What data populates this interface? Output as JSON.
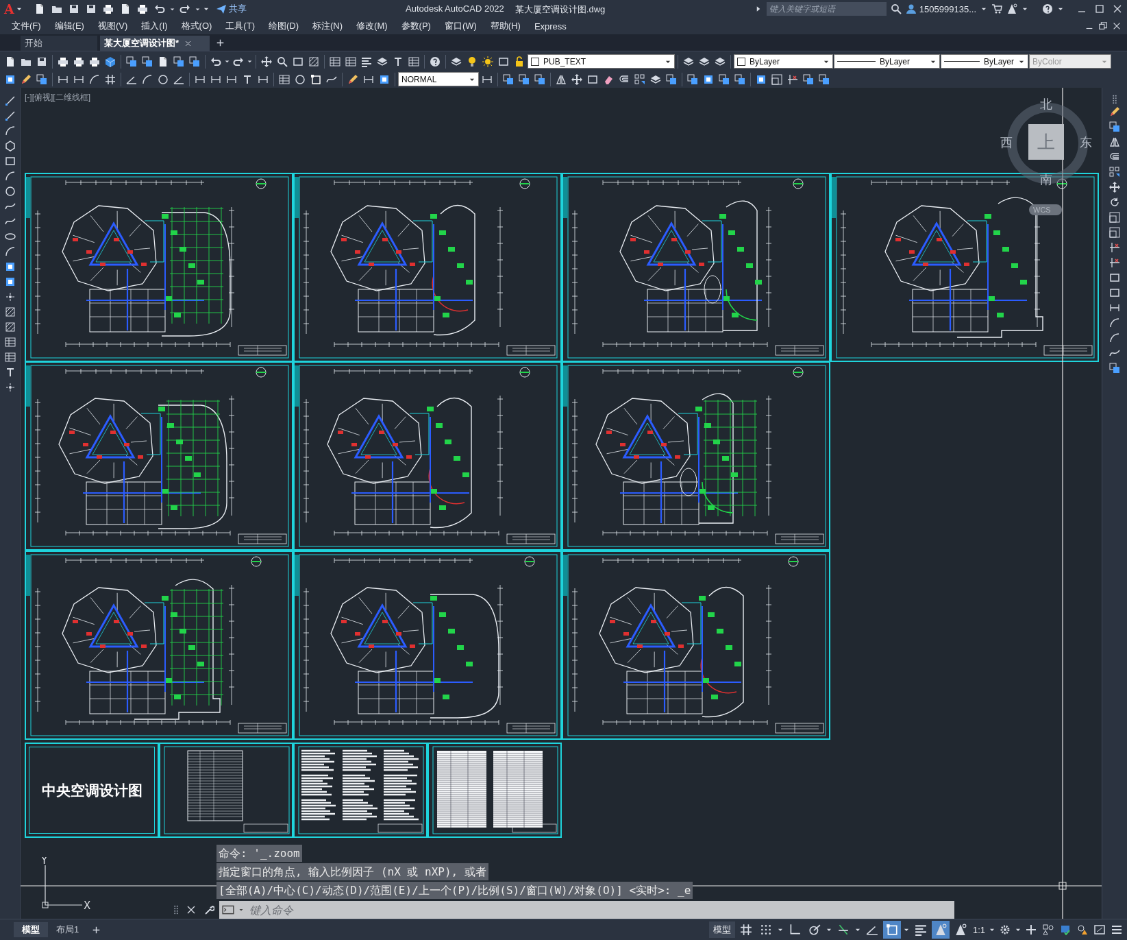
{
  "app": {
    "logo": "A",
    "share": "共享",
    "title": "Autodesk AutoCAD 2022",
    "file": "某大厦空调设计图.dwg",
    "search_placeholder": "键入关键字或短语",
    "user": "1505999135..."
  },
  "menu": [
    "文件(F)",
    "编辑(E)",
    "视图(V)",
    "插入(I)",
    "格式(O)",
    "工具(T)",
    "绘图(D)",
    "标注(N)",
    "修改(M)",
    "参数(P)",
    "窗口(W)",
    "帮助(H)",
    "Express"
  ],
  "doc_tabs": [
    {
      "label": "开始",
      "selected": false
    },
    {
      "label": "某大厦空调设计图*",
      "selected": true
    }
  ],
  "toolbar_combos": [
    {
      "kind": "layer",
      "value": "PUB_TEXT",
      "disabled": false
    },
    {
      "kind": "color",
      "value": "ByLayer",
      "disabled": false
    },
    {
      "kind": "linetype",
      "value": "ByLayer",
      "disabled": false
    },
    {
      "kind": "lineweight",
      "value": "ByLayer",
      "disabled": false
    },
    {
      "kind": "plotstyle",
      "value": "ByColor",
      "disabled": true
    },
    {
      "kind": "style",
      "value": "NORMAL",
      "disabled": false
    }
  ],
  "viewport": {
    "label": "[-][俯视][二维线框]"
  },
  "viewcube": {
    "north": "北",
    "south": "南",
    "west": "西",
    "east": "东",
    "face": "上",
    "ucs": "WCS"
  },
  "sheets": [
    {
      "kind": "plan"
    },
    {
      "kind": "plan"
    },
    {
      "kind": "plan"
    },
    {
      "kind": "plan"
    },
    {
      "kind": "plan"
    },
    {
      "kind": "plan"
    },
    {
      "kind": "plan"
    },
    {
      "kind": "plan"
    },
    {
      "kind": "plan"
    },
    {
      "kind": "plan"
    },
    {
      "kind": "title",
      "text": "中央空调设计图"
    },
    {
      "kind": "table"
    },
    {
      "kind": "notes"
    },
    {
      "kind": "table"
    }
  ],
  "ucs_icon": {
    "x": "X",
    "y": "Y"
  },
  "command_history": [
    "命令: '_.zoom",
    "指定窗口的角点, 输入比例因子 (nX 或 nXP), 或者",
    "[全部(A)/中心(C)/动态(D)/范围(E)/上一个(P)/比例(S)/窗口(W)/对象(O)] <实时>: _e"
  ],
  "command_input": {
    "placeholder": "键入命令"
  },
  "layout_tabs": [
    {
      "label": "模型",
      "selected": true
    },
    {
      "label": "布局1",
      "selected": false
    }
  ],
  "status_bar": {
    "space": "模型",
    "scale": "1:1"
  },
  "status_toggles": [
    {
      "kind": "grid",
      "on": false
    },
    {
      "kind": "snap",
      "on": false
    },
    {
      "kind": "ortho",
      "on": false
    },
    {
      "kind": "polar",
      "on": false
    },
    {
      "kind": "track",
      "on": false
    },
    {
      "kind": "angle",
      "on": false
    },
    {
      "kind": "osnap",
      "on": true
    },
    {
      "kind": "lineweight",
      "on": false
    },
    {
      "kind": "annovisible",
      "on": true
    },
    {
      "kind": "autoscale",
      "on": false
    }
  ]
}
